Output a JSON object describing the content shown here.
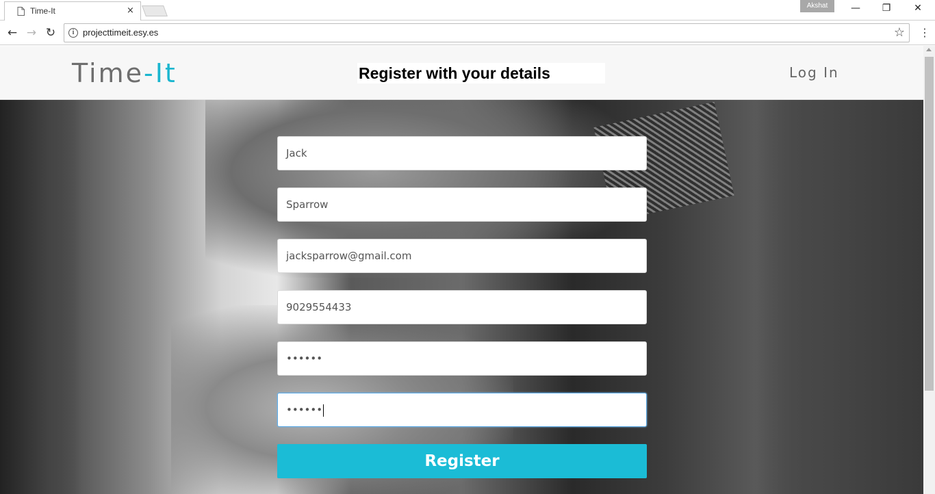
{
  "browser": {
    "tab_title": "Time-It",
    "tab_close": "×",
    "profile_name": "Akshat",
    "url": "projecttimeit.esy.es",
    "minimize": "—",
    "restore": "❐",
    "close": "✕",
    "back": "←",
    "forward": "→",
    "reload": "↻",
    "bookmark_star": "☆",
    "menu": "⋮",
    "info": "i"
  },
  "site": {
    "logo_main": "Time",
    "logo_accent": "-It",
    "heading": "Register with your details",
    "login_label": "Log In",
    "accent_color": "#1ab6cf"
  },
  "form": {
    "first_name": "Jack",
    "last_name": "Sparrow",
    "email": "jacksparrow@gmail.com",
    "phone": "9029554433",
    "password": "••••••",
    "confirm_password": "••••••",
    "register_label": "Register"
  }
}
